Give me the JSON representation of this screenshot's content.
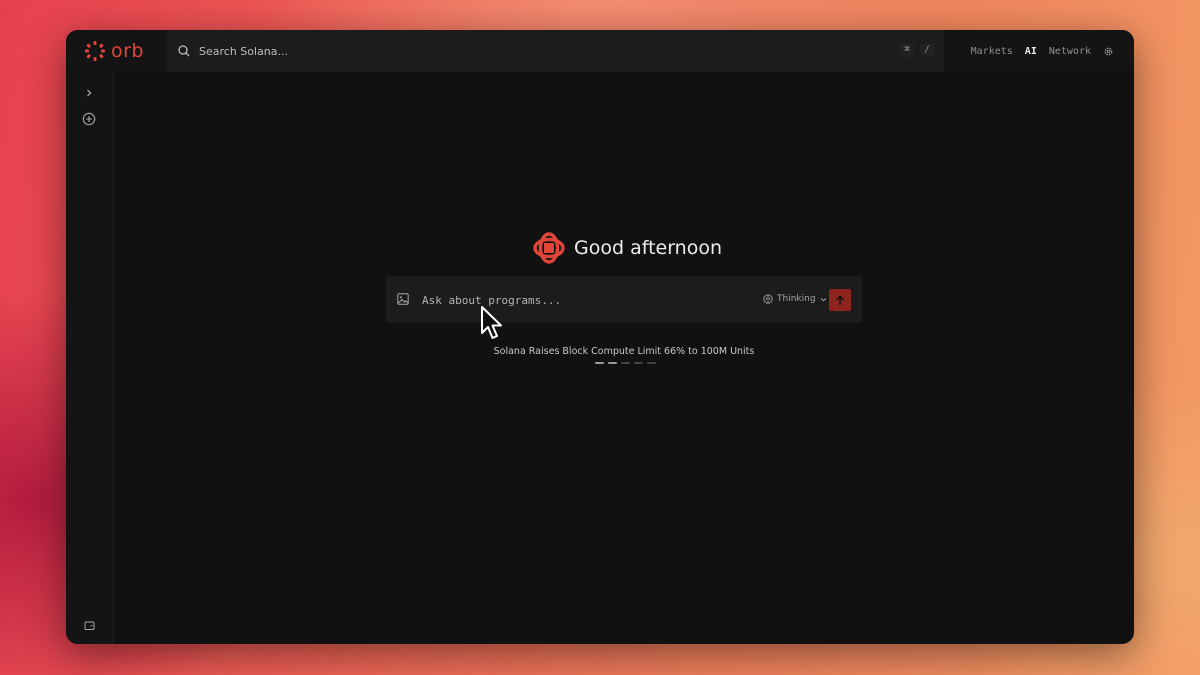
{
  "app": {
    "logo_text": "orb",
    "brand_color": "#e0453a"
  },
  "search": {
    "placeholder": "Search Solana...",
    "shortcut_keys": [
      "⌘",
      "/"
    ]
  },
  "nav": {
    "items": [
      {
        "label": "Markets",
        "active": false
      },
      {
        "label": "AI",
        "active": true
      },
      {
        "label": "Network",
        "active": false
      }
    ],
    "settings_icon": "gear-icon"
  },
  "sidebar": {
    "expand_icon": "chevron-right-icon",
    "new_chat_icon": "plus-circle-icon",
    "bottom_icon": "wallet-icon"
  },
  "main": {
    "greeting": "Good afternoon",
    "prompt": {
      "placeholder": "Ask about programs...",
      "mode_label": "Thinking",
      "send_icon": "arrow-up-icon",
      "send_color": "#8f241f"
    },
    "news": {
      "headline": "Solana Raises Block Compute Limit 66% to 100M Units",
      "carousel_count": 5,
      "carousel_active": [
        0,
        1
      ]
    }
  }
}
